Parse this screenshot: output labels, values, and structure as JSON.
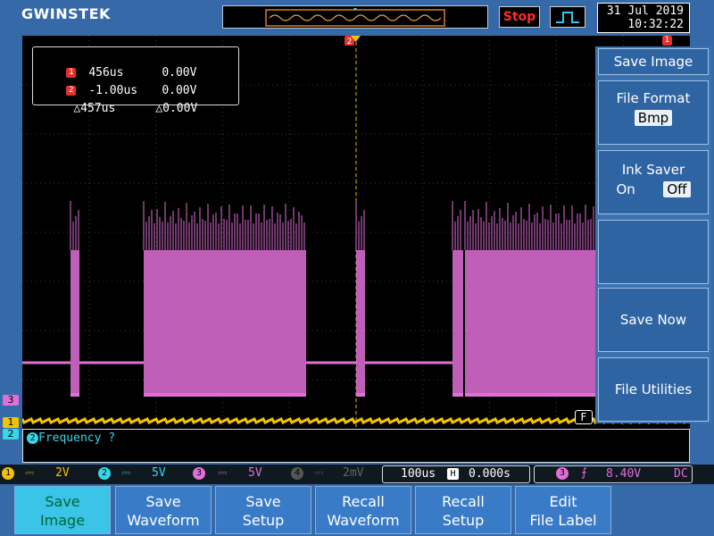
{
  "header": {
    "logo": "GWINSTEK",
    "stop_label": "Stop",
    "date": "31 Jul 2019",
    "time": "10:32:22"
  },
  "cursor": {
    "c1_badge": "1",
    "c1_time": "456us",
    "c1_volt": "0.00V",
    "c2_badge": "2",
    "c2_time": "-1.00us",
    "c2_volt": "0.00V",
    "dt": "△457us",
    "dv": "△0.00V"
  },
  "markers": {
    "cursor2": "2",
    "cursor1": "1",
    "ch3": "3",
    "ch1": "1",
    "ch2": "2",
    "f_marker": "F"
  },
  "side_menu": {
    "title": "Save Image",
    "file_format_label": "File Format",
    "file_format_value": "Bmp",
    "ink_saver_label": "Ink Saver",
    "ink_on": "On",
    "ink_off": "Off",
    "save_now": "Save Now",
    "file_utilities": "File Utilities"
  },
  "status": {
    "prompt": "Frequency ?"
  },
  "channels": {
    "ch1_scale": "2V",
    "ch2_scale": "5V",
    "ch3_scale": "5V",
    "ch4_scale": "2mV",
    "timebase": "100us",
    "h_pos": "0.000s",
    "trig_level": "8.40V",
    "coupling": "DC"
  },
  "bottom_menu": [
    {
      "line1": "Save",
      "line2": "Image"
    },
    {
      "line1": "Save",
      "line2": "Waveform"
    },
    {
      "line1": "Save",
      "line2": "Setup"
    },
    {
      "line1": "Recall",
      "line2": "Waveform"
    },
    {
      "line1": "Recall",
      "line2": "Setup"
    },
    {
      "line1": "Edit",
      "line2": "File Label"
    }
  ],
  "colors": {
    "ch1": "#f2c300",
    "ch2": "#38d7e8",
    "ch3": "#e070d8",
    "accent": "#39c4e8"
  }
}
